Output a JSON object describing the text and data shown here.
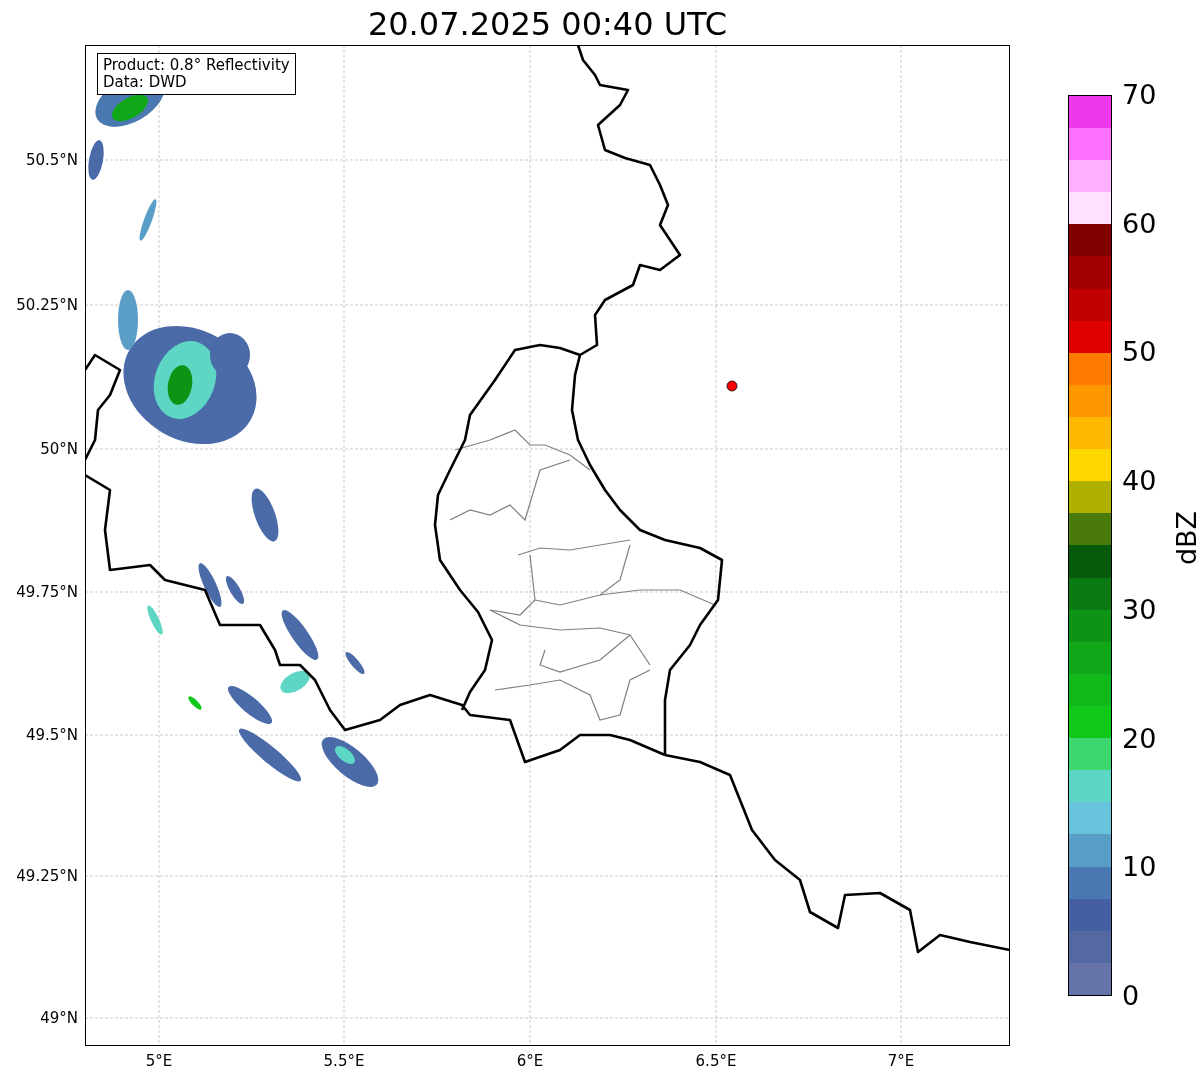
{
  "title": "20.07.2025 00:40 UTC",
  "map": {
    "info_box": [
      "Product: 0.8° Reflectivity",
      "Data: DWD"
    ],
    "y_ticks": [
      "50.5°N",
      "50.25°N",
      "50°N",
      "49.75°N",
      "49.5°N",
      "49.25°N",
      "49°N"
    ],
    "x_ticks": [
      "5°E",
      "5.5°E",
      "6°E",
      "6.5°E",
      "7°E"
    ]
  },
  "colorbar": {
    "label": "dBZ",
    "ticks": [
      "70",
      "60",
      "50",
      "40",
      "30",
      "20",
      "10",
      "0"
    ],
    "bins": [
      {
        "color": "#6573a8"
      },
      {
        "color": "#5468a2"
      },
      {
        "color": "#4560a2"
      },
      {
        "color": "#4a78b0"
      },
      {
        "color": "#5a9ec8"
      },
      {
        "color": "#68c4dc"
      },
      {
        "color": "#5dd6c4"
      },
      {
        "color": "#3ed66e"
      },
      {
        "color": "#10c81a"
      },
      {
        "color": "#10b81a"
      },
      {
        "color": "#10a818"
      },
      {
        "color": "#0d9414"
      },
      {
        "color": "#0c7a12"
      },
      {
        "color": "#085a0c"
      },
      {
        "color": "#4a7a0a"
      },
      {
        "color": "#b0b000"
      },
      {
        "color": "#ffd800"
      },
      {
        "color": "#ffb800"
      },
      {
        "color": "#ff9800"
      },
      {
        "color": "#ff7a00"
      },
      {
        "color": "#e00000"
      },
      {
        "color": "#c00000"
      },
      {
        "color": "#a00000"
      },
      {
        "color": "#800000"
      },
      {
        "color": "#ffe0ff"
      },
      {
        "color": "#ffb0ff"
      },
      {
        "color": "#ff70ff"
      },
      {
        "color": "#ee38ee"
      }
    ]
  }
}
